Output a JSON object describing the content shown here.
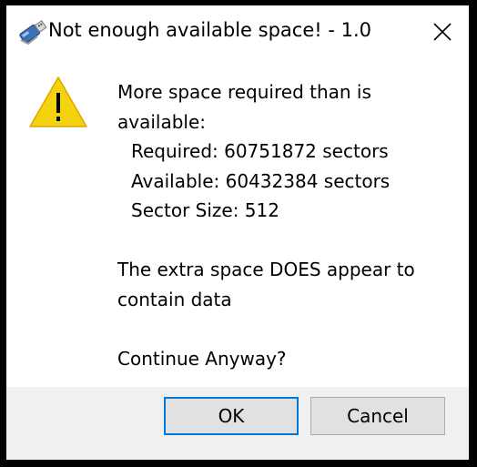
{
  "window": {
    "title": "Not enough available space! - 1.0",
    "app_icon": "usb-drive-icon",
    "close_icon": "close-icon"
  },
  "message": {
    "icon": "warning-icon",
    "line1": "More space required than is",
    "line2": "available:",
    "required": "Required: 60751872 sectors",
    "available": "Available: 60432384 sectors",
    "sector_size": "Sector Size: 512",
    "extra_line1": "The extra space DOES appear to",
    "extra_line2": "contain data",
    "question": "Continue Anyway?"
  },
  "buttons": {
    "ok_label": "OK",
    "cancel_label": "Cancel"
  },
  "colors": {
    "warning_yellow": "#f5d20f",
    "focus_border": "#0078d7",
    "footer_bg": "#f0f0f0"
  }
}
